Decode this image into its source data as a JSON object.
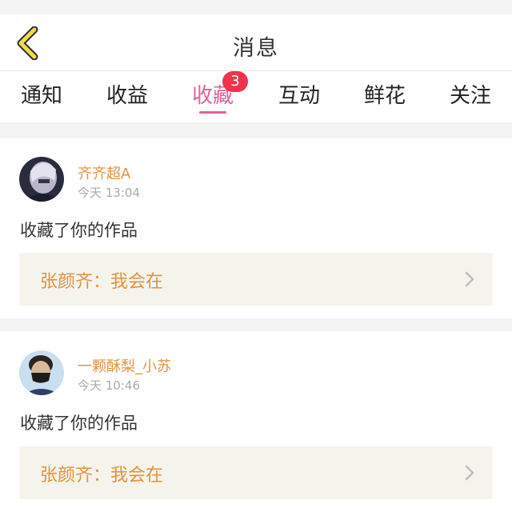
{
  "header": {
    "title": "消息",
    "back_icon": "chevron-left-icon"
  },
  "tabs": [
    {
      "label": "通知",
      "active": false
    },
    {
      "label": "收益",
      "active": false
    },
    {
      "label": "收藏",
      "active": true,
      "badge": "3"
    },
    {
      "label": "互动",
      "active": false
    },
    {
      "label": "鲜花",
      "active": false
    },
    {
      "label": "关注",
      "active": false
    }
  ],
  "messages": [
    {
      "username": "齐齐超A",
      "time": "今天 13:04",
      "action": "收藏了你的作品",
      "quote": "张颜齐：我会在",
      "avatar": "avatar-anime-character"
    },
    {
      "username": "一颗酥梨_小苏",
      "time": "今天 10:46",
      "action": "收藏了你的作品",
      "quote": "张颜齐：我会在",
      "avatar": "avatar-person-masked"
    }
  ],
  "colors": {
    "accent": "#e0609a",
    "badge": "#f0334a",
    "username": "#e4913d",
    "quote_bg": "#f4f4ec",
    "back_icon_yellow": "#f5d94a"
  }
}
